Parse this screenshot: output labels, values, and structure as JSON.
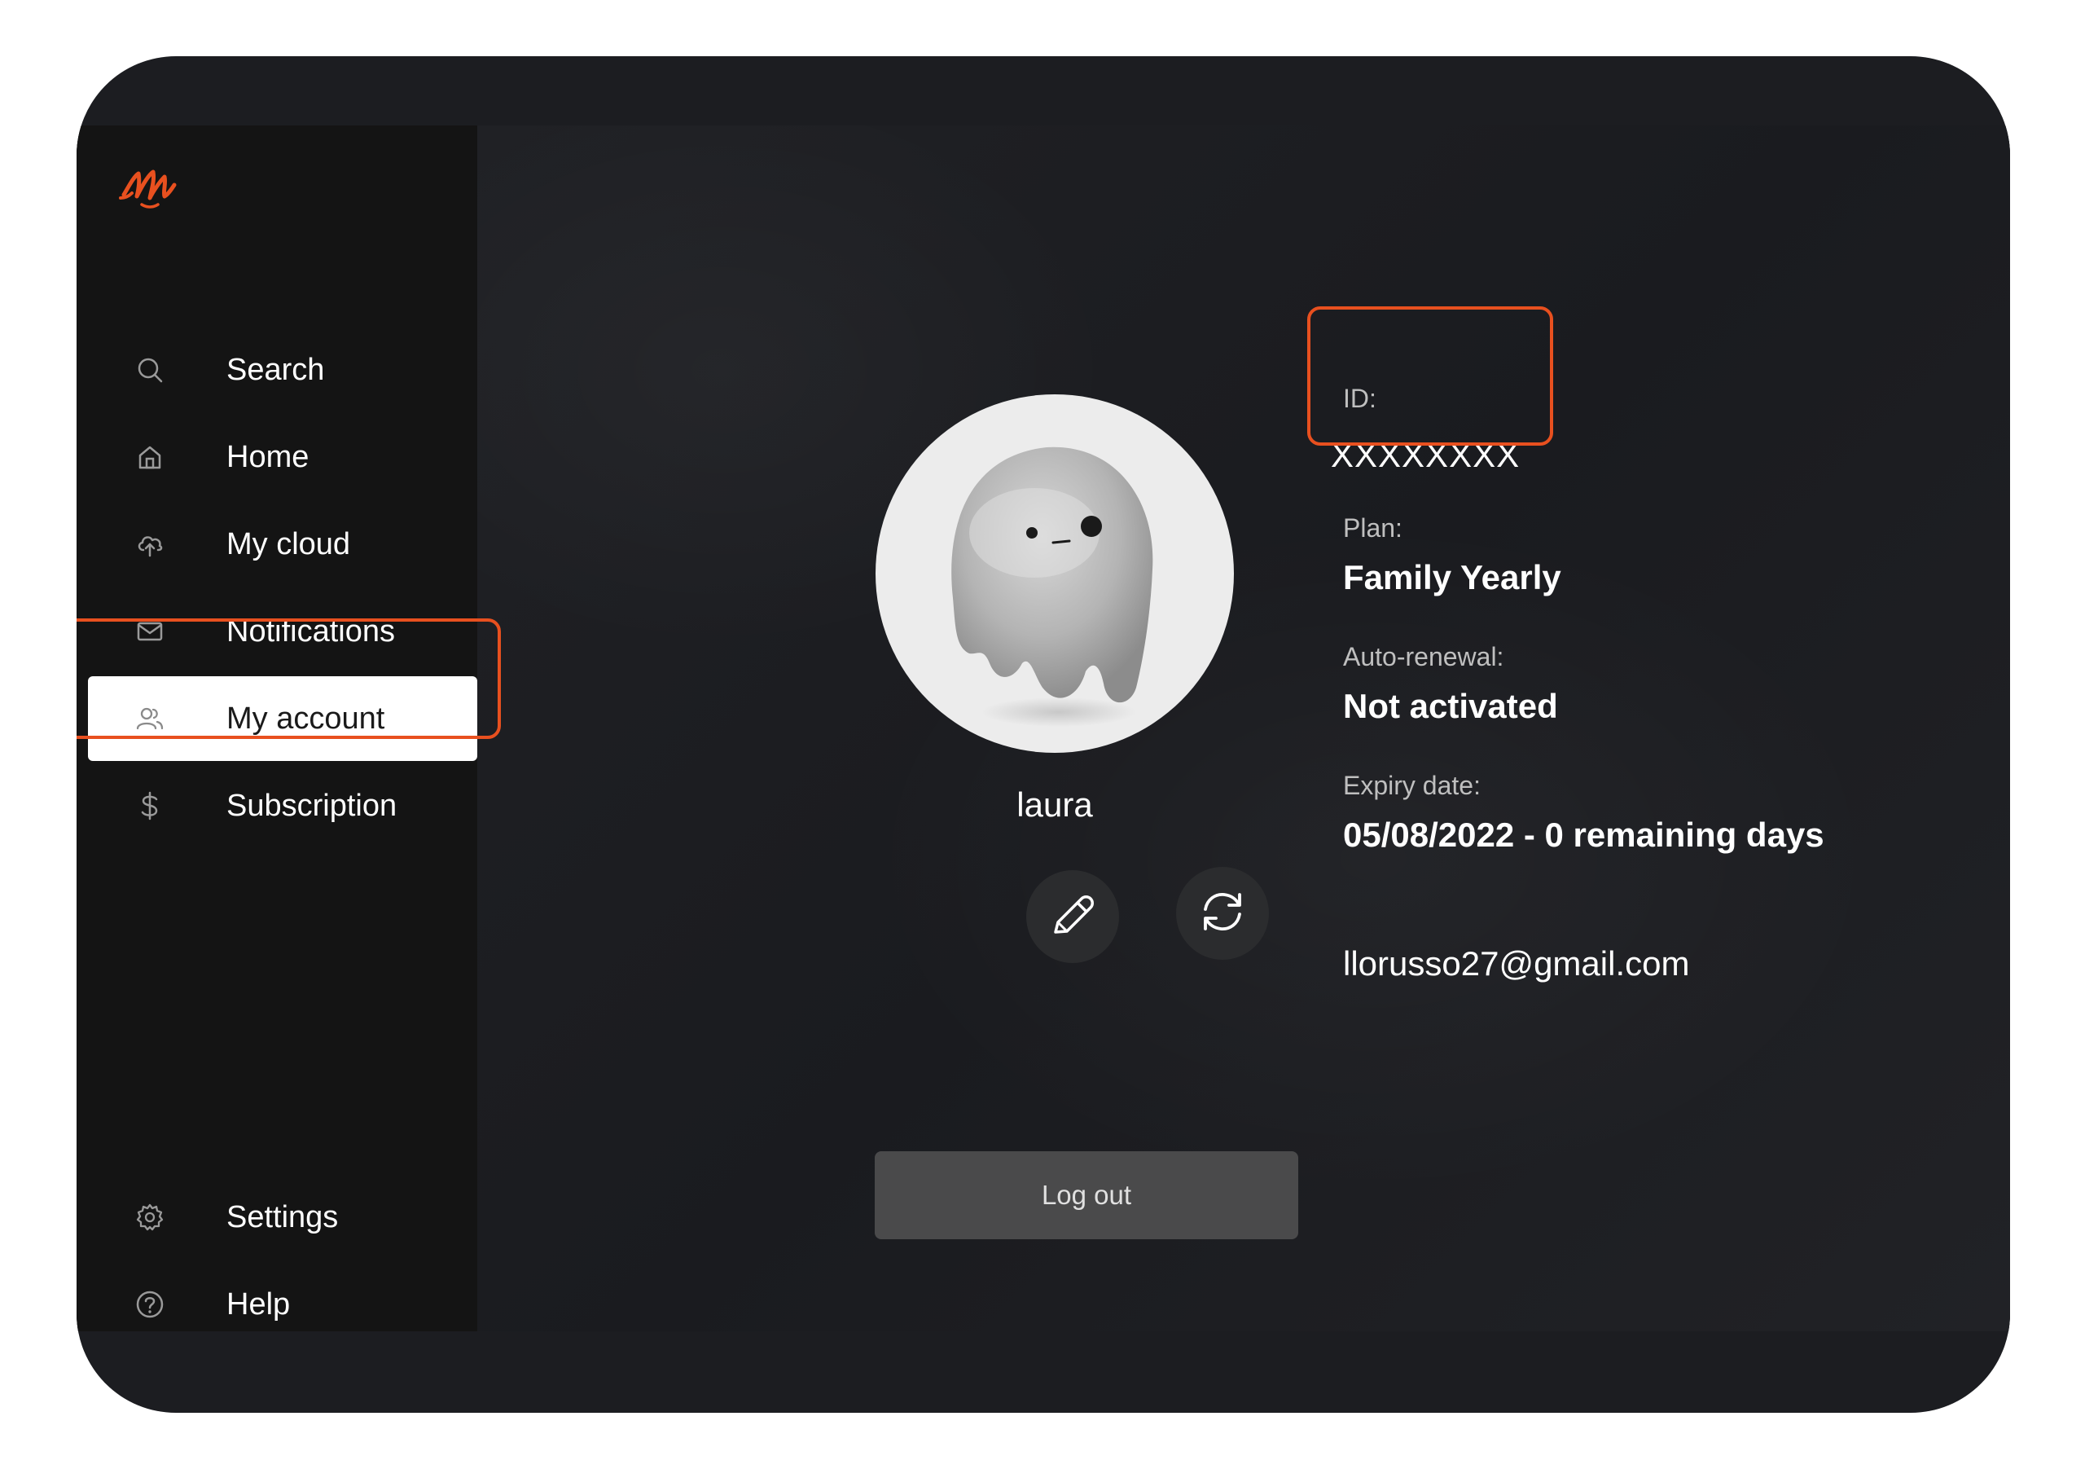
{
  "brand": {
    "logo_icon": "m-script-logo-icon",
    "accent_color": "#e8501f"
  },
  "sidebar": {
    "items": [
      {
        "label": "Search",
        "icon": "search-icon"
      },
      {
        "label": "Home",
        "icon": "home-icon"
      },
      {
        "label": "My cloud",
        "icon": "cloud-upload-icon"
      },
      {
        "label": "Notifications",
        "icon": "mail-icon"
      },
      {
        "label": "My account",
        "icon": "users-icon",
        "active": true
      },
      {
        "label": "Subscription",
        "icon": "dollar-icon"
      }
    ],
    "bottom_items": [
      {
        "label": "Settings",
        "icon": "gear-icon"
      },
      {
        "label": "Help",
        "icon": "help-circle-icon"
      }
    ]
  },
  "profile": {
    "username": "laura",
    "edit_icon": "pencil-icon",
    "refresh_icon": "refresh-icon"
  },
  "account": {
    "id_label": "ID:",
    "id_value": "XXXXXXXX",
    "plan_label": "Plan:",
    "plan_value": "Family Yearly",
    "renewal_label": "Auto-renewal:",
    "renewal_value": "Not activated",
    "expiry_label": "Expiry date:",
    "expiry_value": "05/08/2022 - 0 remaining days",
    "email": "llorusso27@gmail.com"
  },
  "actions": {
    "logout_label": "Log out"
  }
}
